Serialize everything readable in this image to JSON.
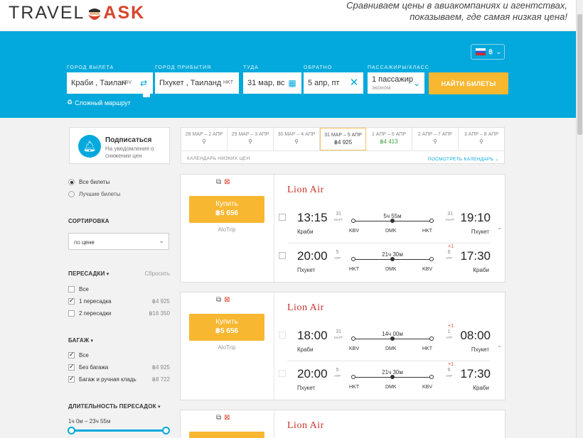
{
  "header": {
    "logo_left": "TRAVEL",
    "logo_right": "ASK",
    "tagline_1": "Сравниваем цены в авиакомпаниях и агентствах,",
    "tagline_2": "показываем, где самая низкая цена!"
  },
  "currency": {
    "symbol": "฿",
    "flag": "russia-flag-icon"
  },
  "search": {
    "from_label": "ГОРОД ВЫЛЕТА",
    "from_value": "Краби , Таилан",
    "from_code": "KBV",
    "to_label": "ГОРОД ПРИБЫТИЯ",
    "to_value": "Пхукет , Таиланд",
    "to_code": "HKT",
    "depart_label": "ТУДА",
    "depart_value": "31 мар, вс",
    "return_label": "ОБРАТНО",
    "return_value": "5 апр, пт",
    "pax_label": "ПАССАЖИРЫ/КЛАСС",
    "pax_value": "1 пассажир",
    "pax_class": "эконом",
    "submit": "НАЙТИ БИЛЕТЫ",
    "complex": "Сложный маршрут"
  },
  "subscribe": {
    "title": "Подписаться",
    "text": "На уведомления о снижении цен"
  },
  "calendar": {
    "cells": [
      {
        "range": "28 МАР – 2 АПР",
        "price": ""
      },
      {
        "range": "29 МАР – 3 АПР",
        "price": ""
      },
      {
        "range": "30 МАР – 4 АПР",
        "price": ""
      },
      {
        "range": "31 МАР – 5 АПР",
        "price": "฿4 925"
      },
      {
        "range": "1 АПР – 6 АПР",
        "price": "฿4 413"
      },
      {
        "range": "2 АПР – 7 АПР",
        "price": ""
      },
      {
        "range": "3 АПР – 8 АПР",
        "price": ""
      }
    ],
    "footer": "КАЛЕНДАРЬ НИЗКИХ ЦЕН",
    "link": "ПОСМОТРЕТЬ КАЛЕНДАРЬ"
  },
  "filters": {
    "all_tickets": "Все билеты",
    "best_tickets": "Лучшие билеты",
    "sort_header": "СОРТИРОВКА",
    "sort_prefix": "по",
    "sort_value": "цене",
    "transfers_header": "ПЕРЕСАДКИ",
    "reset": "Сбросить",
    "transfers": [
      {
        "label": "Все",
        "price": ""
      },
      {
        "label": "1 пересадка",
        "price": "฿4 925"
      },
      {
        "label": "2 пересадки",
        "price": "฿16 350"
      }
    ],
    "baggage_header": "БАГАЖ",
    "baggage": [
      {
        "label": "Все",
        "price": ""
      },
      {
        "label": "Без багажа",
        "price": "฿4 925"
      },
      {
        "label": "Багаж и ручная кладь",
        "price": "฿8 722"
      }
    ],
    "duration_header": "ДЛИТЕЛЬНОСТЬ ПЕРЕСАДОК",
    "duration_range": "1ч 0м – 23ч 55м"
  },
  "tickets": [
    {
      "buy": "Купить",
      "price": "฿5 656",
      "agency": "AloTrip",
      "airline": "Lion Air",
      "segments": [
        {
          "dep_time": "13:15",
          "dep_day": "31",
          "dep_mon": "МАРТ",
          "arr_time": "19:10",
          "arr_day": "31",
          "arr_mon": "МАРТ",
          "plus": "",
          "dur": "5ч 55м",
          "from_city": "Краби",
          "to_city": "Пхукет",
          "a1": "KBV",
          "a2": "DMK",
          "a3": "HKT"
        },
        {
          "dep_time": "20:00",
          "dep_day": "5",
          "dep_mon": "АПР",
          "arr_time": "17:30",
          "arr_day": "6",
          "arr_mon": "АПР",
          "plus": "+1",
          "dur": "21ч 30м",
          "from_city": "Пхукет",
          "to_city": "Краби",
          "a1": "HKT",
          "a2": "DMK",
          "a3": "KBV"
        }
      ]
    },
    {
      "buy": "Купить",
      "price": "฿5 656",
      "agency": "AloTrip",
      "airline": "Lion Air",
      "segments": [
        {
          "dep_time": "18:00",
          "dep_day": "31",
          "dep_mon": "МАРТ",
          "arr_time": "08:00",
          "arr_day": "1",
          "arr_mon": "АПР",
          "plus": "+1",
          "dur": "14ч 00м",
          "from_city": "Краби",
          "to_city": "Пхукет",
          "a1": "KBV",
          "a2": "DMK",
          "a3": "HKT"
        },
        {
          "dep_time": "20:00",
          "dep_day": "5",
          "dep_mon": "АПР",
          "arr_time": "17:30",
          "arr_day": "6",
          "arr_mon": "АПР",
          "plus": "+1",
          "dur": "21ч 30м",
          "from_city": "Пхукет",
          "to_city": "Краби",
          "a1": "HKT",
          "a2": "DMK",
          "a3": "KBV"
        }
      ]
    },
    {
      "airline": "Lion Air"
    }
  ]
}
